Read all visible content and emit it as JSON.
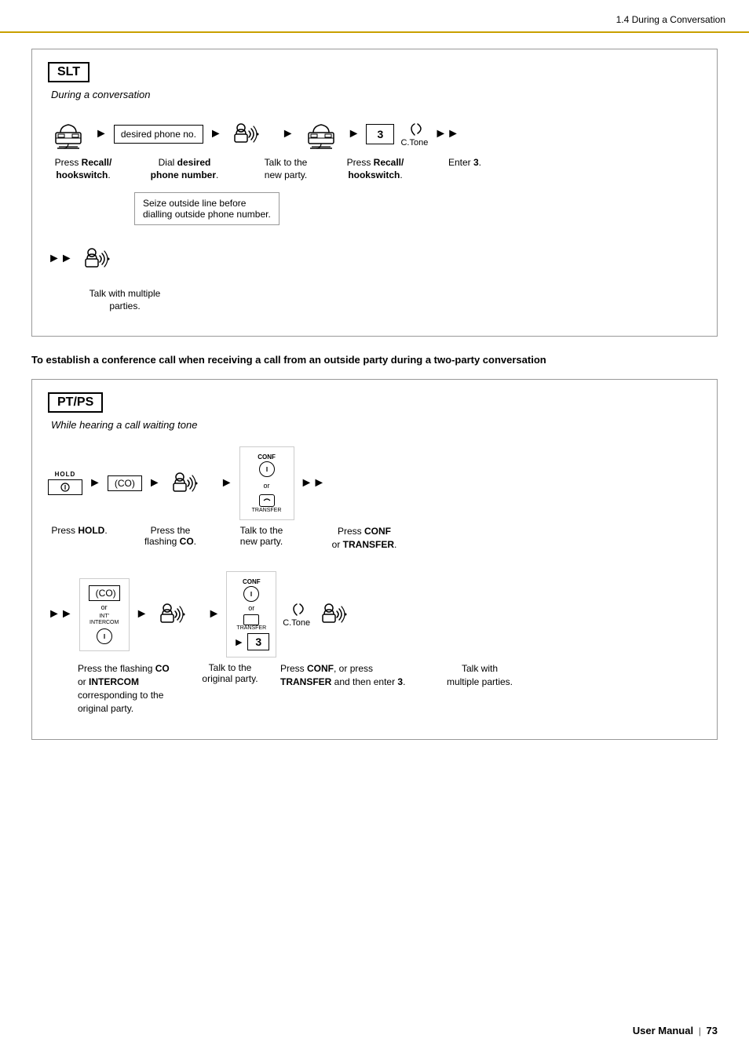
{
  "header": {
    "title": "1.4 During a Conversation"
  },
  "slt_section": {
    "box_label": "SLT",
    "subtitle": "During a conversation",
    "flow_steps": [
      {
        "type": "phone"
      },
      {
        "type": "arrow"
      },
      {
        "type": "desired_phone"
      },
      {
        "type": "arrow"
      },
      {
        "type": "talk"
      },
      {
        "type": "arrow"
      },
      {
        "type": "phone"
      },
      {
        "type": "arrow"
      },
      {
        "type": "number3"
      },
      {
        "type": "ctone"
      },
      {
        "type": "double_arrow"
      }
    ],
    "labels": [
      {
        "text": "Press Recall/\nhookswitch.",
        "bold_parts": [
          "Recall/",
          "hookswitch"
        ]
      },
      {
        "text": "Dial desired\nphone number.",
        "bold_parts": [
          "desired",
          "phone number"
        ]
      },
      {
        "text": "Talk to the\nnew party."
      },
      {
        "text": "Press Recall/\nhookswitch.",
        "bold_parts": [
          "Recall/",
          "hookswitch"
        ]
      },
      {
        "text": "Enter 3.",
        "bold_parts": [
          "3"
        ]
      }
    ],
    "note": "Seize outside line before\ndialling outside phone number.",
    "bottom_flow": {
      "double_arrow": true,
      "talk_icon": true
    },
    "bottom_label": "Talk with multiple parties."
  },
  "conference_heading": "To establish a conference call when receiving a call from an outside party during a two-party\nconversation",
  "ptps_section": {
    "box_label": "PT/PS",
    "subtitle": "While hearing a call waiting tone",
    "top_flow": [
      {
        "type": "hold_btn"
      },
      {
        "type": "arrow"
      },
      {
        "type": "co_box"
      },
      {
        "type": "arrow"
      },
      {
        "type": "talk"
      },
      {
        "type": "arrow"
      },
      {
        "type": "conf_transfer_group"
      },
      {
        "type": "double_arrow"
      }
    ],
    "top_labels": [
      {
        "text": "Press HOLD.",
        "bold": "HOLD"
      },
      {
        "text": "Press the\nflashing CO.",
        "bold": "CO"
      },
      {
        "text": "Talk to the\nnew party."
      },
      {
        "text": "Press CONF\nor TRANSFER.",
        "bold": [
          "CONF",
          "TRANSFER"
        ]
      }
    ],
    "bottom_flow": [
      {
        "type": "double_arrow"
      },
      {
        "type": "co_intercom_group"
      },
      {
        "type": "arrow"
      },
      {
        "type": "talk"
      },
      {
        "type": "arrow"
      },
      {
        "type": "conf_transfer_number_group"
      },
      {
        "type": "ctone_talk"
      }
    ],
    "bottom_labels": [
      {
        "text": "Press the flashing CO or\nINTERCOM corresponding\nto the original party.",
        "bold": [
          "CO",
          "INTERCOM"
        ]
      },
      {
        "text": "Talk to the\noriginal party."
      },
      {
        "text": "Press CONF, or press TRANSFER\nand then enter 3.",
        "bold": [
          "CONF",
          "TRANSFER",
          "3"
        ]
      },
      {
        "text": "Talk with\nmultiple parties."
      }
    ]
  },
  "footer": {
    "text": "User Manual",
    "page": "73"
  },
  "labels": {
    "desired_phone": "desired\nphone no.",
    "number3": "3",
    "ctone": "C.Tone",
    "hold": "HOLD",
    "co": "(CO)",
    "conf": "CONF",
    "transfer": "TRANSFER",
    "intercom": "INT'\nINTERCOM",
    "or": "or"
  }
}
